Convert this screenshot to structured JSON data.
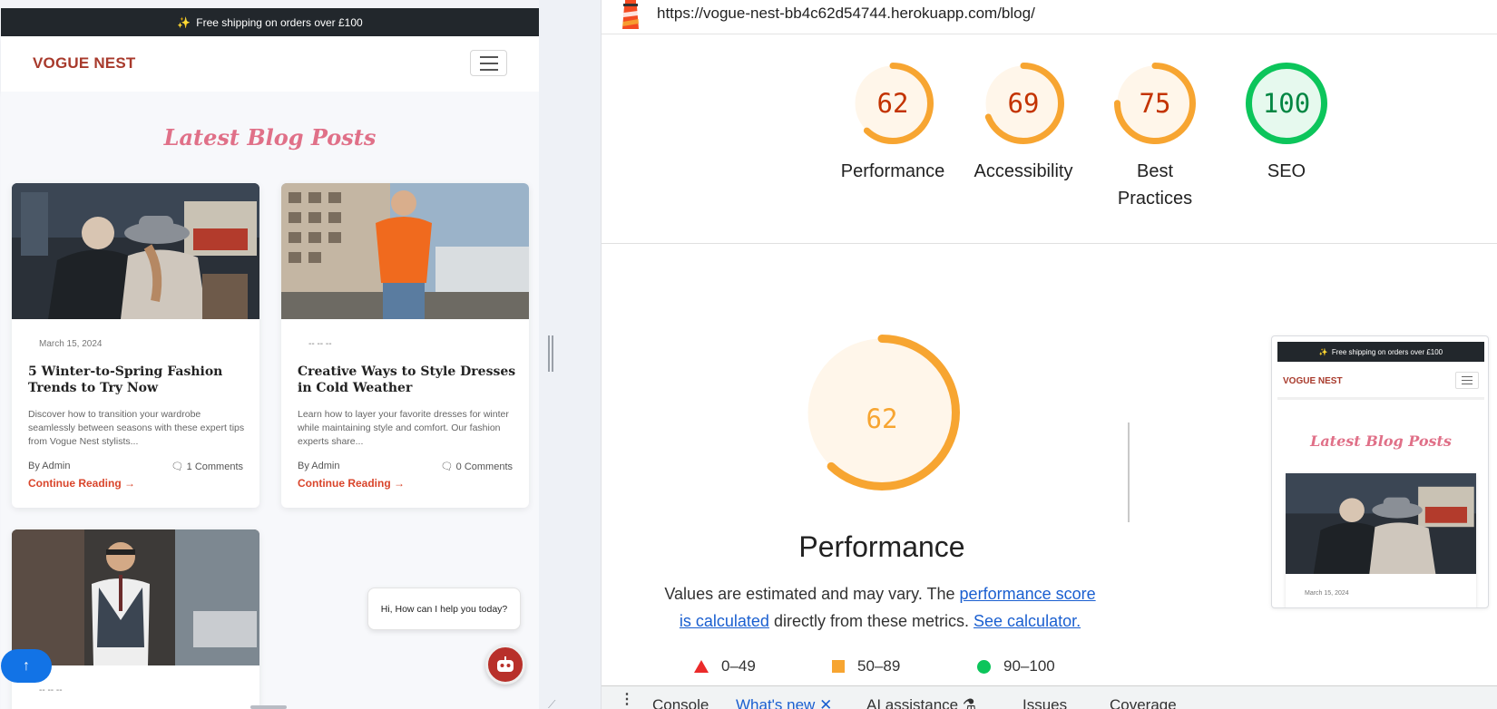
{
  "site": {
    "promo_icon": "sparkles-icon",
    "promo_text": "Free shipping on orders over £100",
    "brand": "VOGUE NEST",
    "section_title": "Latest Blog Posts",
    "cards": [
      {
        "date": "March 15, 2024",
        "title": "5 Winter-to-Spring Fashion Trends to Try Now",
        "excerpt": "Discover how to transition your wardrobe seamlessly between seasons with these expert tips from Vogue Nest stylists...",
        "author": "By Admin",
        "comments": "1 Comments",
        "read_more": "Continue Reading →"
      },
      {
        "date": "-- -- --",
        "title": "Creative Ways to Style Dresses in Cold Weather",
        "excerpt": "Learn how to layer your favorite dresses for winter while maintaining style and comfort. Our fashion experts share...",
        "author": "By Admin",
        "comments": "0 Comments",
        "read_more": "Continue Reading →"
      },
      {
        "date": "-- -- --"
      }
    ],
    "chat_prompt": "Hi, How can I help you today?",
    "scroll_top": "↑"
  },
  "lighthouse": {
    "url": "https://vogue-nest-bb4c62d54744.herokuapp.com/blog/",
    "scores": [
      {
        "label": "Performance",
        "value": "62",
        "score": 62,
        "color": "#f7a531",
        "text_color": "#c33300",
        "bg": "#fff6ea"
      },
      {
        "label": "Accessibility",
        "value": "69",
        "score": 69,
        "color": "#f7a531",
        "text_color": "#c33300",
        "bg": "#fff6ea"
      },
      {
        "label": "Best Practices",
        "value": "75",
        "score": 75,
        "color": "#f7a531",
        "text_color": "#c33300",
        "bg": "#fff6ea"
      },
      {
        "label": "SEO",
        "value": "100",
        "score": 100,
        "color": "#0cc55b",
        "text_color": "#018642",
        "bg": "#e6f9ee"
      }
    ],
    "main": {
      "value": "62",
      "score": 62,
      "label": "Performance",
      "desc_prefix": "Values are estimated and may vary. The ",
      "desc_link1": "performance score is calculated",
      "desc_middle": " directly from these metrics. ",
      "desc_link2": "See calculator."
    },
    "legend": [
      {
        "shape": "triangle",
        "range": "0–49"
      },
      {
        "shape": "square",
        "range": "50–89"
      },
      {
        "shape": "circle",
        "range": "90–100"
      }
    ],
    "thumbnail": {
      "promo": "Free shipping on orders over £100",
      "brand": "VOGUE NEST",
      "title": "Latest Blog Posts",
      "date": "March 15, 2024"
    }
  },
  "devtools_tabs": {
    "menu_icon": "kebab-menu-icon",
    "console": "Console",
    "whats_new": "What's new",
    "ai": "AI assistance",
    "issues": "Issues",
    "coverage": "Coverage"
  }
}
